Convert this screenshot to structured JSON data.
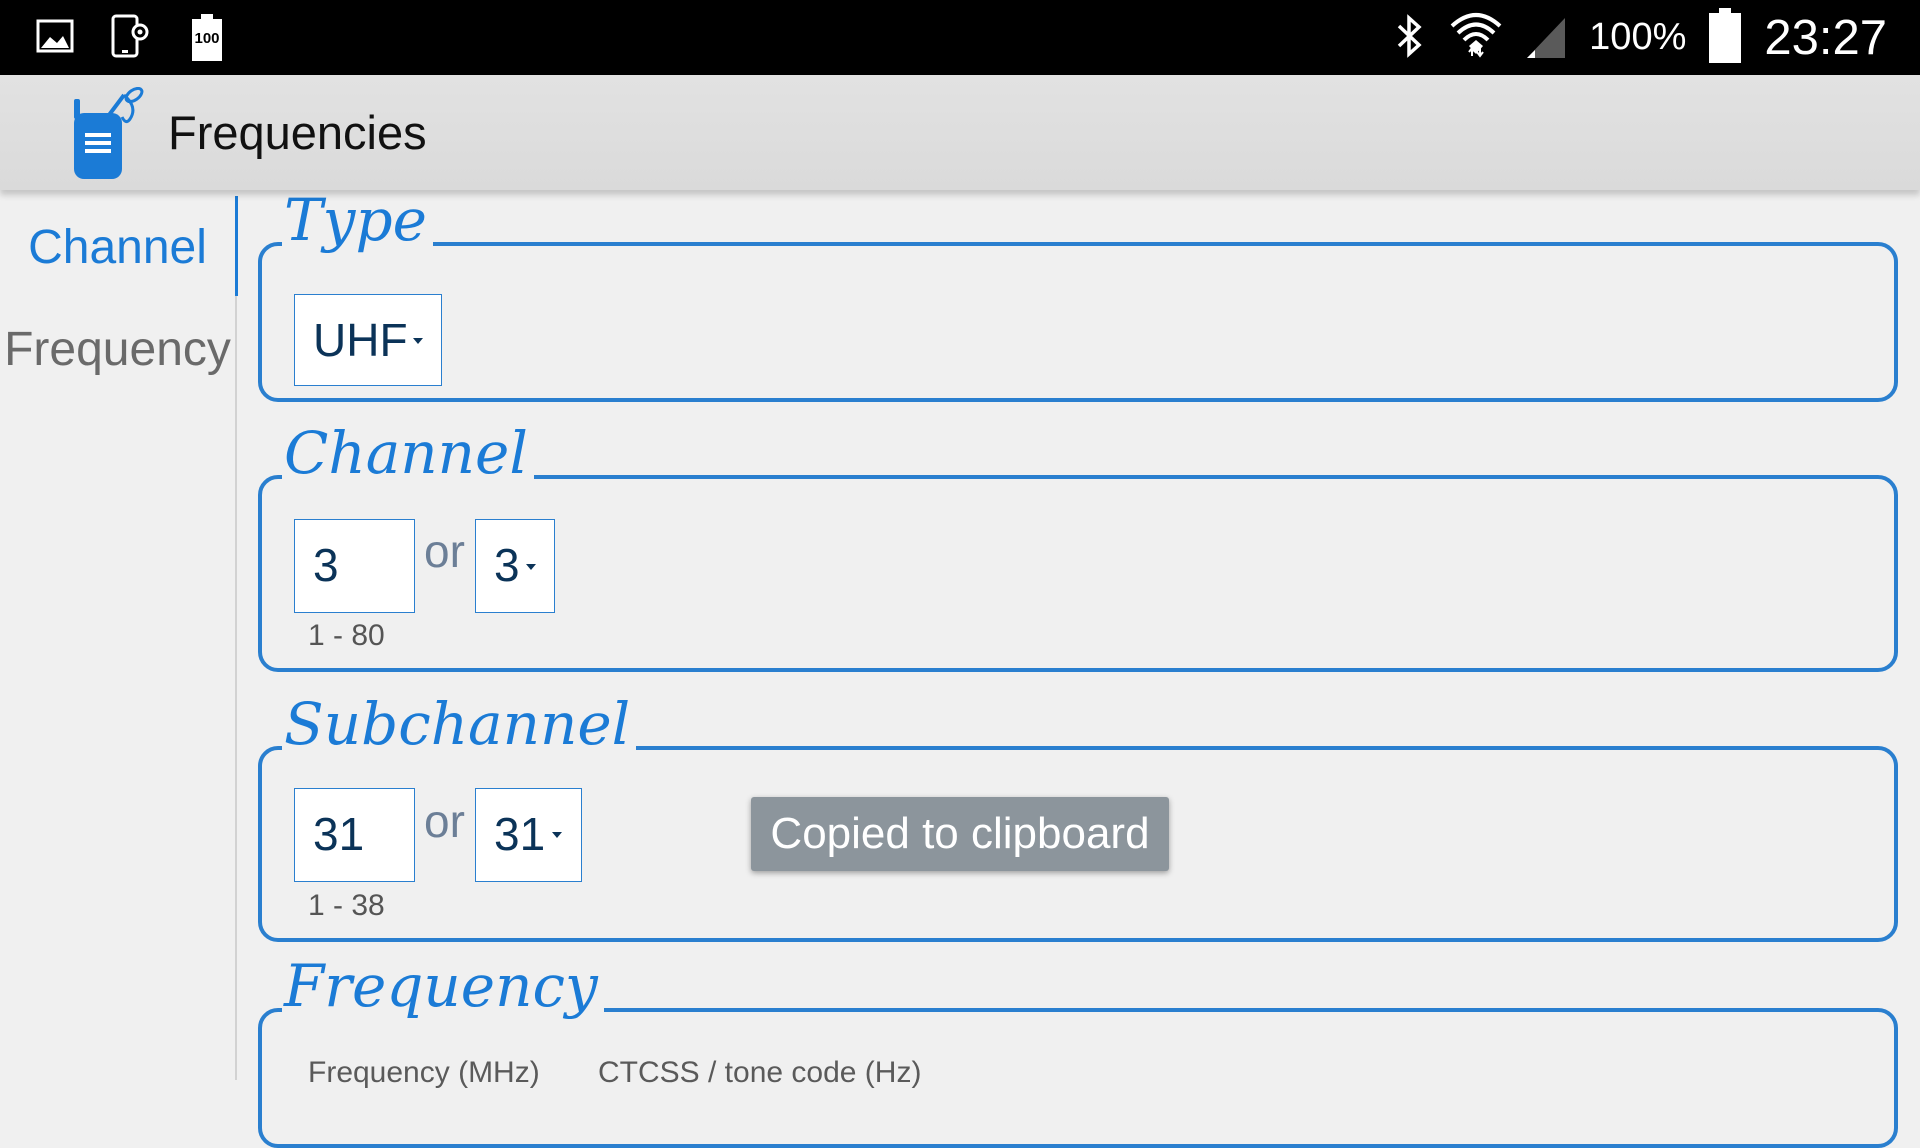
{
  "status_bar": {
    "battery_small_label": "100",
    "battery_percent": "100%",
    "time": "23:27",
    "icons": [
      "gallery-icon",
      "screen-settings-icon",
      "battery-100-icon",
      "bluetooth-icon",
      "wifi-icon",
      "signal-icon",
      "battery-icon"
    ]
  },
  "app_bar": {
    "title": "Frequencies",
    "icon": "walkie-talkie-icon"
  },
  "sidebar": {
    "items": [
      {
        "label": "Channel",
        "active": true
      },
      {
        "label": "Frequency",
        "active": false
      }
    ]
  },
  "sections": {
    "type": {
      "title": "Type",
      "selected": "UHF"
    },
    "channel": {
      "title": "Channel",
      "input_value": "3",
      "or_label": "or",
      "dropdown_value": "3",
      "range": "1 - 80"
    },
    "subchannel": {
      "title": "Subchannel",
      "input_value": "31",
      "or_label": "or",
      "dropdown_value": "31",
      "range": "1 - 38"
    },
    "frequency": {
      "title": "Frequency",
      "col_frequency": "Frequency (MHz)",
      "col_ctcss": "CTCSS / tone code (Hz)"
    }
  },
  "toast": {
    "message": "Copied to clipboard"
  },
  "colors": {
    "accent": "#1b7bd6",
    "border": "#2a7fcf",
    "status_bar": "#000000",
    "toast_bg": "#8c959c"
  }
}
